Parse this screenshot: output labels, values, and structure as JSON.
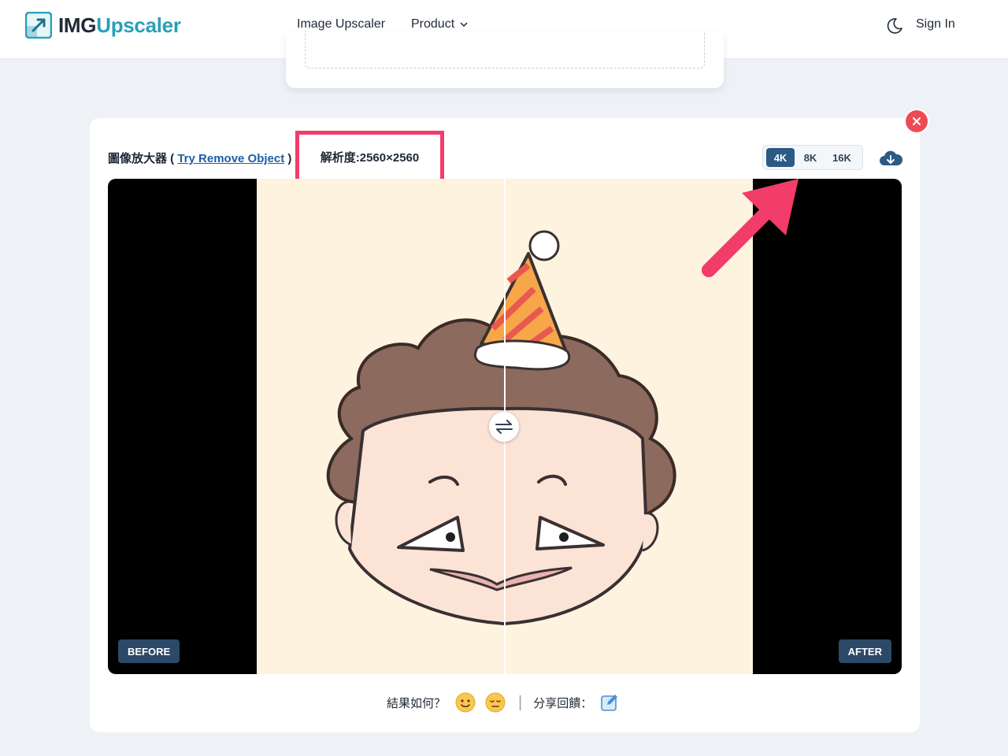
{
  "header": {
    "logo_prefix": "IMG",
    "logo_suffix": "Upscaler",
    "nav_upscaler": "Image Upscaler",
    "nav_product": "Product",
    "sign_in": "Sign In"
  },
  "main": {
    "title_prefix": "圖像放大器 ( ",
    "title_link": "Try Remove Object",
    "title_suffix": " )",
    "resolution": "解析度:2560×2560",
    "scale_options": [
      "4K",
      "8K",
      "16K"
    ],
    "scale_selected": "4K",
    "before_label": "BEFORE",
    "after_label": "AFTER"
  },
  "feedback": {
    "question": "結果如何？",
    "share": "分享回饋："
  },
  "colors": {
    "accent": "#2c5a85",
    "brand": "#2a9fb8",
    "highlight": "#f23c6a",
    "close": "#ef4b55"
  },
  "icons": [
    "logo-icon",
    "chevron-down-icon",
    "moon-icon",
    "close-icon",
    "cloud-download-icon",
    "swap-icon",
    "smile-emoji-icon",
    "meh-emoji-icon",
    "edit-icon",
    "annotation-arrow"
  ]
}
